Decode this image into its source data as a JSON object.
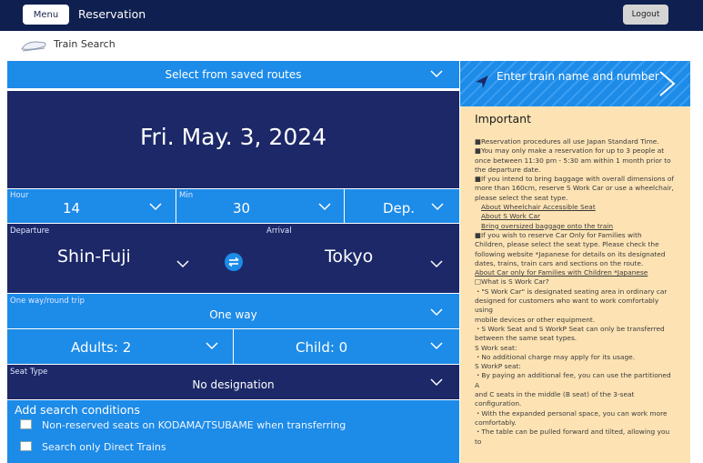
{
  "header": {
    "menu_label": "Menu",
    "title": "Reservation",
    "logout_label": "Logout"
  },
  "subheader": {
    "label": "Train Search"
  },
  "search": {
    "saved_routes": "Select from saved routes",
    "date": "Fri. May. 3, 2024",
    "hour_label": "Hour",
    "hour_value": "14",
    "min_label": "Min",
    "min_value": "30",
    "dep_value": "Dep.",
    "departure_label": "Departure",
    "departure_value": "Shin-Fuji",
    "arrival_label": "Arrival",
    "arrival_value": "Tokyo",
    "trip_label": "One way/round trip",
    "trip_value": "One way",
    "adults": "Adults: 2",
    "child": "Child: 0",
    "seat_label": "Seat Type",
    "seat_value": "No designation",
    "conditions_title": "Add search conditions",
    "cond_1": "Non-reserved seats on KODAMA/TSUBAME when transferring",
    "cond_2": "Search only Direct Trains"
  },
  "train_name": {
    "label": "Enter train name and number"
  },
  "important": {
    "title": "Important",
    "lines": [
      "■Reservation procedures all use Japan Standard Time.",
      "■You may only make a reservation for up to 3 people at",
      "once between 11:30 pm - 5:30 am within 1 month prior to",
      "the departure date.",
      "■If you intend to bring baggage with overall dimensions of",
      "more than 160cm, reserve S Work Car or use a wheelchair,",
      "please select the seat type."
    ],
    "links": [
      "About Wheelchair Accessible Seat",
      "About S Work Car",
      "Bring oversized baggage onto the train"
    ],
    "lines2": [
      "■If you wish to reserve Car Only for Families with",
      "Children, please select the seat type. Please check the",
      "following website *Japanese for details on its designated",
      "dates, trains, train cars and sections on the route."
    ],
    "link_family": "About Car only for Families with Children *Japanese",
    "lines3": [
      "□What is S Work Car?",
      "・\"S Work Car\" is designated seating area in ordinary car",
      "designed for customers who want to work comfortably using",
      "mobile devices or other equipment.",
      "・S Work Seat and S WorkP Seat can only be transferred",
      "between the same seat types.",
      "S Work seat:",
      "・No additional charge may apply for its usage.",
      "S WorkP seat:",
      "・By paying an additional fee, you can use the partitioned A",
      "and C seats in the middle (B seat) of the 3-seat",
      "configuration.",
      "・With the expanded personal space, you can work more",
      "comfortably.",
      "・The table can be pulled forward and tilted, allowing you to"
    ]
  },
  "colors": {
    "navy": "#1c2868",
    "blue": "#1d8be8",
    "topbar": "#0f1f4f",
    "notice_bg": "#fde3b4"
  },
  "icons": [
    "train-icon",
    "chevron-down-icon",
    "swap-icon",
    "send-arrow-icon",
    "chevron-right-icon"
  ]
}
